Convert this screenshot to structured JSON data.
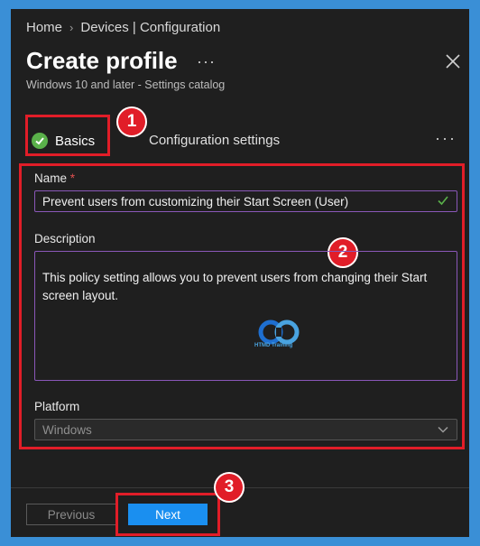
{
  "breadcrumb": {
    "home": "Home",
    "separator": "›",
    "current": "Devices | Configuration"
  },
  "header": {
    "title": "Create profile",
    "more": "···",
    "subtitle": "Windows 10 and later - Settings catalog"
  },
  "tabs": [
    {
      "label": "Basics",
      "state": "completed"
    },
    {
      "label": "Configuration settings",
      "state": "upcoming"
    }
  ],
  "tabs_more": "···",
  "annotations": {
    "one": "1",
    "two": "2",
    "three": "3"
  },
  "form": {
    "name_label": "Name",
    "required_mark": "*",
    "name_value": "Prevent users from customizing their Start Screen (User)",
    "description_label": "Description",
    "description_value": "This policy setting allows you to prevent users from changing their Start screen layout.",
    "watermark": "HTMD Training",
    "platform_label": "Platform",
    "platform_value": "Windows"
  },
  "footer": {
    "previous_label": "Previous",
    "next_label": "Next"
  },
  "colors": {
    "accent": "#1a8ff0",
    "annotation": "#e11d28",
    "success": "#5ab04a",
    "input_border": "#8a57b8",
    "background": "#1f1f1f"
  }
}
